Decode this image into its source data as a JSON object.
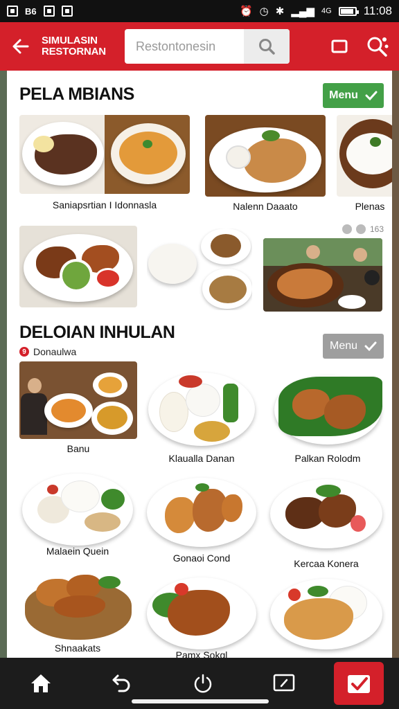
{
  "status_bar": {
    "left_text": "B6",
    "time": "11:08",
    "signal_label": "4G"
  },
  "app_bar": {
    "title": "SIMULASIN RESTORNAN",
    "search_placeholder": "Restontonesin"
  },
  "sections": [
    {
      "title": "PELA MBIANS",
      "menu_label": "Menu",
      "captions": [
        "Saniapsrtian I Idonnasla",
        "Nalenn Daaato",
        "Plenas"
      ],
      "badge": "163"
    },
    {
      "title": "DELOIAN INHULAN",
      "subtitle": "Donaulwa",
      "badge_number": "9",
      "menu_label": "Menu",
      "captions": [
        "Banu",
        "Klaualla Danan",
        "Palkan Rolodm",
        "Malaein Quein",
        "Gonaoi Cond",
        "Kercaa Konera",
        "Shnaakats",
        "Pamx Sokgl",
        ""
      ]
    }
  ],
  "colors": {
    "brand_red": "#d4202a",
    "menu_green": "#43a047",
    "menu_gray": "#9e9e9e"
  },
  "nav_icons": [
    "home-icon",
    "undo-icon",
    "power-icon",
    "screen-icon",
    "check-icon"
  ]
}
